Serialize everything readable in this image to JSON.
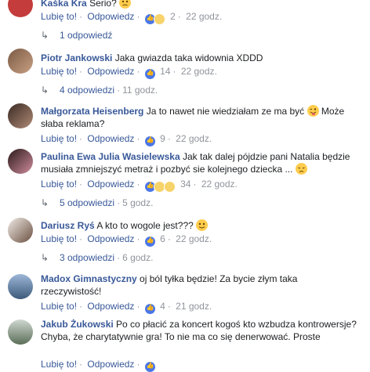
{
  "comments": [
    {
      "name": "Kaśka Kra",
      "text": "Serio?",
      "emoji": "confused-face",
      "like_label": "Lubię to!",
      "reply_label": "Odpowiedz",
      "reactions": [
        "like",
        "sad"
      ],
      "count": "2",
      "time": "22 godz.",
      "replies_label": "1 odpowiedź",
      "replies_time": ""
    },
    {
      "name": "Piotr Jankowski",
      "text": "Jaka gwiazda taka widownia XDDD",
      "like_label": "Lubię to!",
      "reply_label": "Odpowiedz",
      "reactions": [
        "like"
      ],
      "count": "14",
      "time": "22 godz.",
      "replies_label": "4 odpowiedzi",
      "replies_time": "11 godz."
    },
    {
      "name": "Małgorzata Heisenberg",
      "text": "Ja to nawet nie wiedziałam ze ma być",
      "emoji": "winking-tongue-face",
      "text2": "Może słaba reklama?",
      "like_label": "Lubię to!",
      "reply_label": "Odpowiedz",
      "reactions": [
        "like"
      ],
      "count": "9",
      "time": "22 godz."
    },
    {
      "name": "Paulina Ewa Julia Wasielewska",
      "text": "Jak tak dalej pójdzie pani Natalia będzie musiała zmniejszyć metraż i pozbyć sie kolejnego dziecka ...",
      "emoji": "disappointed-face",
      "like_label": "Lubię to!",
      "reply_label": "Odpowiedz",
      "reactions": [
        "like",
        "haha",
        "sad"
      ],
      "count": "34",
      "time": "22 godz.",
      "replies_label": "5 odpowiedzi",
      "replies_time": "5 godz."
    },
    {
      "name": "Dariusz Ryś",
      "text": "A kto to wogole jest???",
      "emoji": "smiling-face",
      "like_label": "Lubię to!",
      "reply_label": "Odpowiedz",
      "reactions": [
        "like"
      ],
      "count": "6",
      "time": "22 godz.",
      "replies_label": "3 odpowiedzi",
      "replies_time": "6 godz."
    },
    {
      "name": "Madox Gimnastyczny",
      "text": "oj ból tyłka będzie! Za bycie złym taka rzeczywistość!",
      "like_label": "Lubię to!",
      "reply_label": "Odpowiedz",
      "reactions": [
        "like"
      ],
      "count": "4",
      "time": "21 godz."
    },
    {
      "name": "Jakub Żukowski",
      "text": "Po co płacić za koncert kogoś kto wzbudza kontrowersje? Chyba, że charytatywnie gra! To nie ma co się denerwować. Proste",
      "like_label": "Lubię to!",
      "reply_label": "Odpowiedz",
      "reactions": [
        "like"
      ],
      "count": "",
      "time": ""
    }
  ]
}
